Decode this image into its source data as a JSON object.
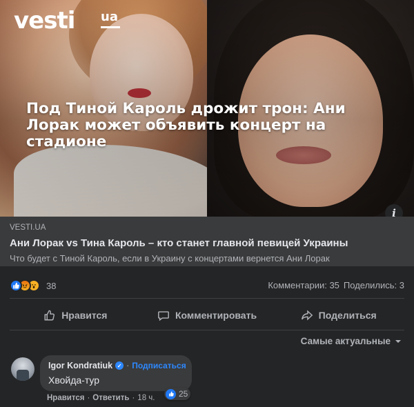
{
  "hero": {
    "logo_main": "vesti",
    "logo_sub": "ua",
    "headline": "Под Тиной Кароль дрожит трон: Ани Лорак может объявить концерт на стадионе",
    "info_icon": "info-icon"
  },
  "link": {
    "domain": "VESTI.UA",
    "title": "Ани Лорак vs Тина Кароль – кто станет главной певицей Украины",
    "description": "Что будет с Тиной Кароль, если в Украину с концертами вернется Ани Лорак"
  },
  "reactions": {
    "icons": [
      "like-icon",
      "angry-icon",
      "wow-icon"
    ],
    "count": "38",
    "comments": "Комментарии: 35",
    "shares": "Поделились: 3"
  },
  "actions": {
    "like": "Нравится",
    "comment": "Комментировать",
    "share": "Поделиться"
  },
  "sort": {
    "label": "Самые актуальные"
  },
  "comment": {
    "author": "Igor Kondratiuk",
    "separator": "·",
    "subscribe": "Подписаться",
    "text": "Хвойда-тур",
    "reaction_count": "25",
    "like_label": "Нравится",
    "reply_label": "Ответить",
    "time": "18 ч."
  },
  "colors": {
    "background": "#242526",
    "card": "#3a3b3c",
    "text": "#e4e6eb",
    "secondary": "#b0b3b8",
    "link": "#2d88ff"
  }
}
